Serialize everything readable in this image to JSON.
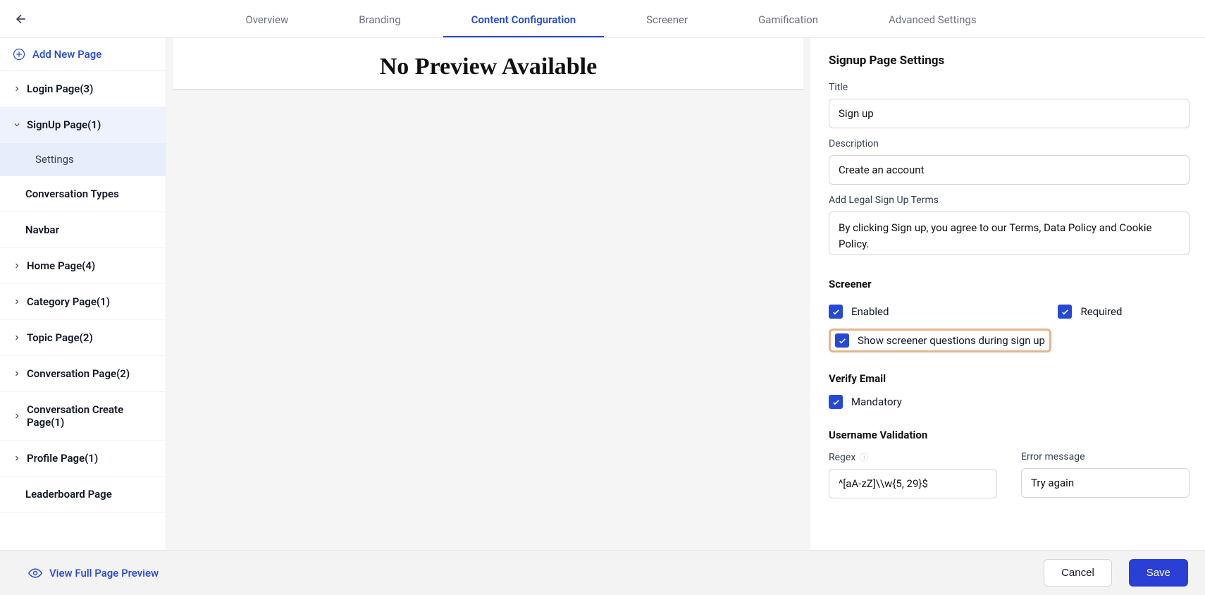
{
  "topbar": {
    "tabs": [
      {
        "label": "Overview",
        "active": false
      },
      {
        "label": "Branding",
        "active": false
      },
      {
        "label": "Content Configuration",
        "active": true
      },
      {
        "label": "Screener",
        "active": false
      },
      {
        "label": "Gamification",
        "active": false
      },
      {
        "label": "Advanced Settings",
        "active": false
      }
    ]
  },
  "sidebar": {
    "add_label": "Add New Page",
    "items": [
      {
        "type": "collapsible",
        "label": "Login Page(3)",
        "expanded": false
      },
      {
        "type": "collapsible",
        "label": "SignUp Page(1)",
        "expanded": true,
        "children": [
          {
            "label": "Settings",
            "selected": true
          }
        ]
      },
      {
        "type": "plain",
        "label": "Conversation Types"
      },
      {
        "type": "plain",
        "label": "Navbar"
      },
      {
        "type": "collapsible",
        "label": "Home Page(4)",
        "expanded": false
      },
      {
        "type": "collapsible",
        "label": "Category Page(1)",
        "expanded": false
      },
      {
        "type": "collapsible",
        "label": "Topic Page(2)",
        "expanded": false
      },
      {
        "type": "collapsible",
        "label": "Conversation Page(2)",
        "expanded": false
      },
      {
        "type": "collapsible",
        "label": "Conversation Create Page(1)",
        "expanded": false
      },
      {
        "type": "collapsible",
        "label": "Profile Page(1)",
        "expanded": false
      },
      {
        "type": "collapsible",
        "label": "Leaderboard Page",
        "expanded": false
      }
    ]
  },
  "preview": {
    "title": "No Preview Available"
  },
  "settings": {
    "heading": "Signup Page Settings",
    "title_label": "Title",
    "title_value": "Sign up",
    "desc_label": "Description",
    "desc_value": "Create an account",
    "legal_label": "Add Legal Sign Up Terms",
    "legal_value": "By clicking Sign up, you agree to our Terms, Data Policy and Cookie Policy.",
    "screener_head": "Screener",
    "screener_enabled": "Enabled",
    "screener_required": "Required",
    "screener_show": "Show screener questions during sign up",
    "verify_head": "Verify Email",
    "verify_mandatory": "Mandatory",
    "username_head": "Username Validation",
    "regex_label": "Regex",
    "regex_value": "^[aA-zZ]\\\\w{5, 29}$",
    "error_label": "Error message",
    "error_value": "Try again"
  },
  "footer": {
    "view_preview": "View Full Page Preview",
    "cancel": "Cancel",
    "save": "Save"
  }
}
